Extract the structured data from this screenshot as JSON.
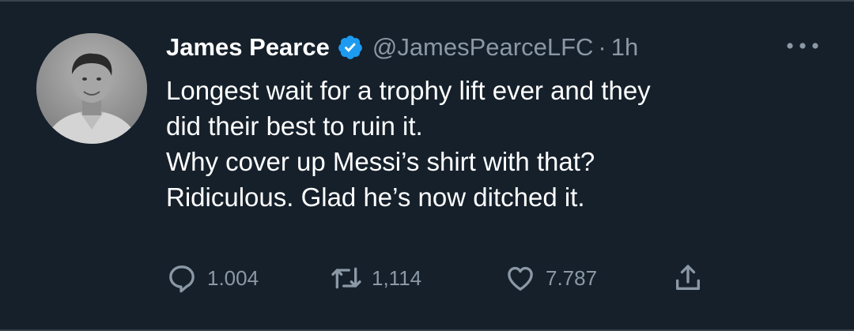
{
  "tweet": {
    "author": {
      "display_name": "James Pearce",
      "handle": "@JamesPearceLFC",
      "verified": true
    },
    "separator": "·",
    "time": "1h",
    "text_lines": [
      "Longest wait for a trophy lift ever and they",
      "did their best to ruin it.",
      "Why cover up Messi’s shirt with that?",
      "Ridiculous. Glad he’s now ditched it."
    ],
    "actions": {
      "replies": "1.004",
      "retweets": "1,114",
      "likes": "7.787"
    },
    "icons": {
      "avatar": "profile-photo",
      "verified": "verified-badge-icon",
      "more": "more-options-icon",
      "reply": "reply-icon",
      "retweet": "retweet-icon",
      "like": "heart-icon",
      "share": "share-icon"
    },
    "colors": {
      "background": "#15202b",
      "primary_text": "#ffffff",
      "secondary_text": "#8b98a5",
      "verified_blue": "#1d9bf0"
    }
  }
}
